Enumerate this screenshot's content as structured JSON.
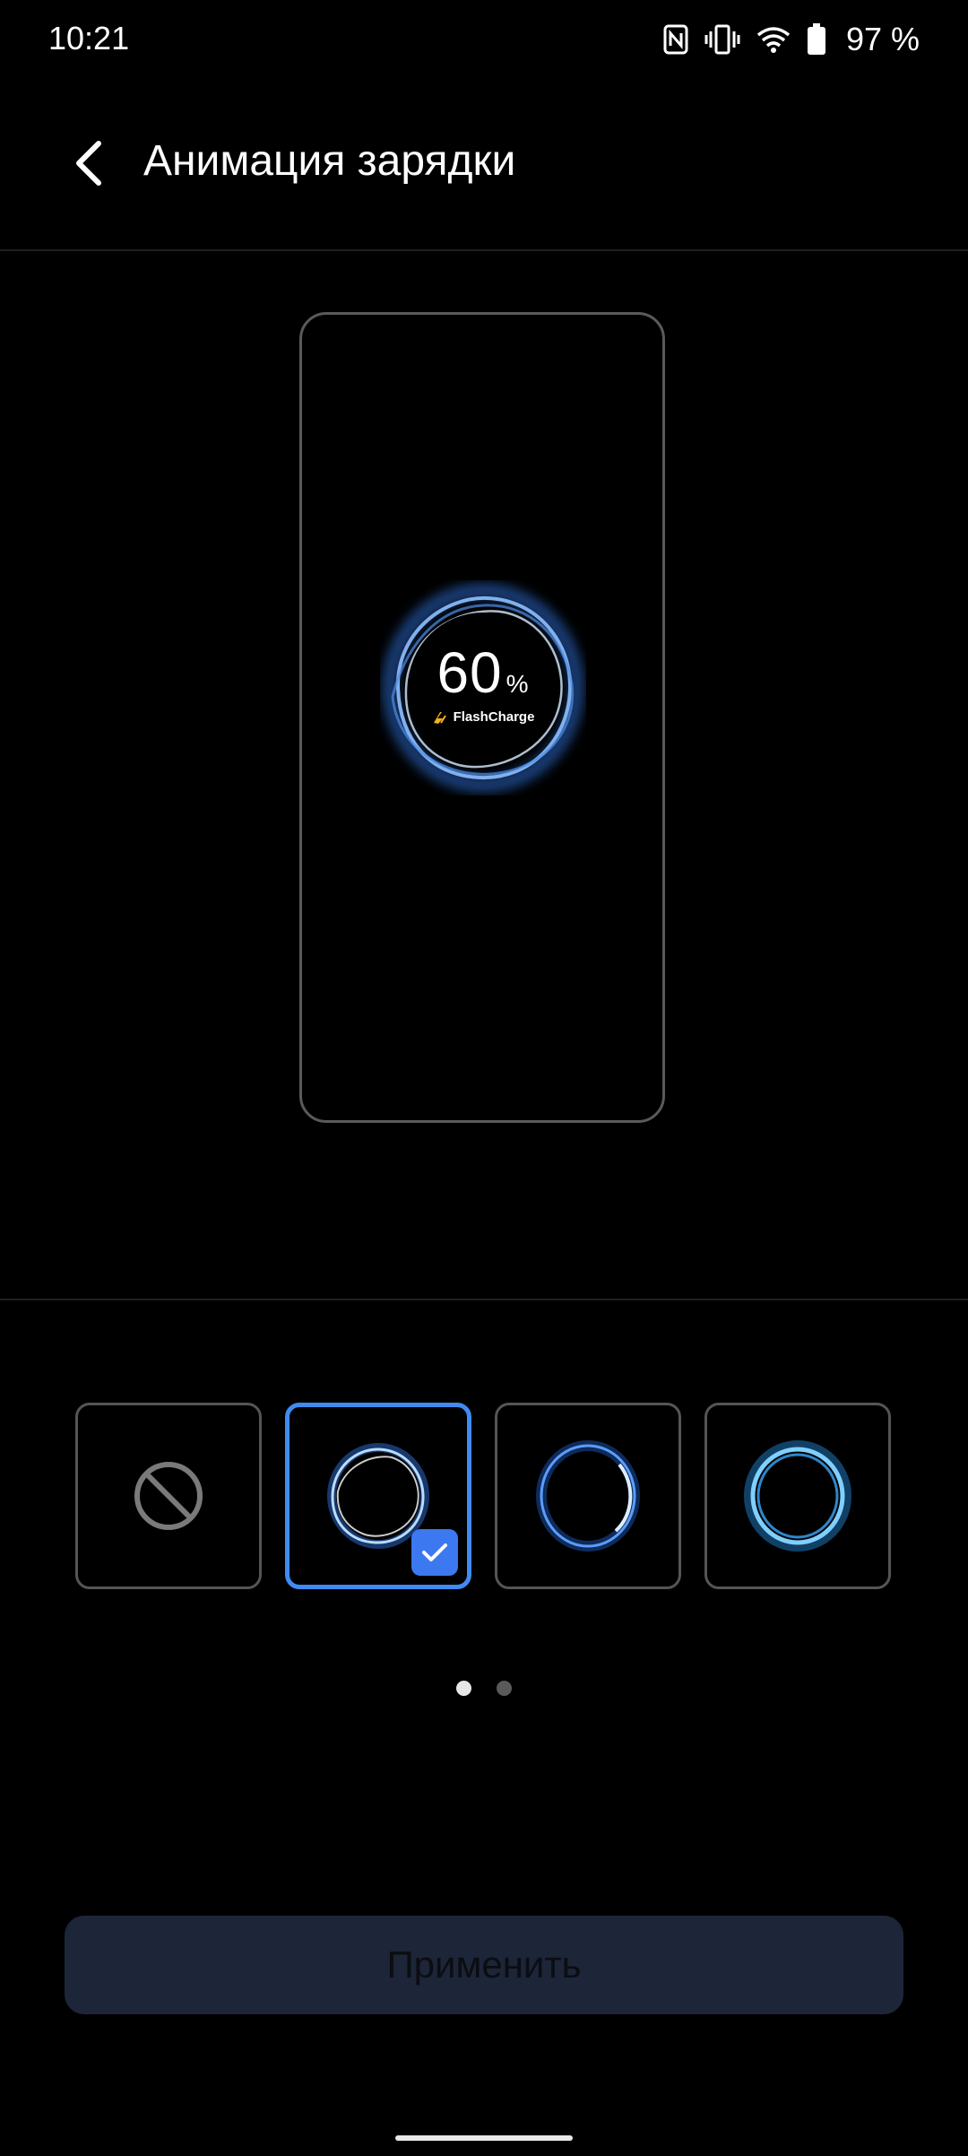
{
  "status_bar": {
    "time": "10:21",
    "icons": [
      "nfc-icon",
      "vibrate-icon",
      "wifi-icon",
      "battery-icon"
    ],
    "battery_text": "97 %"
  },
  "header": {
    "back_icon": "arrow-left-icon",
    "title": "Анимация зарядки"
  },
  "preview": {
    "percent_value": "60",
    "percent_sign": "%",
    "brand": "FlashCharge",
    "accent_color": "#7fb4ff"
  },
  "options": [
    {
      "name": "none",
      "icon": "no-entry-icon",
      "selected": false
    },
    {
      "name": "wave-ring",
      "icon": "wave-ring-icon",
      "selected": true
    },
    {
      "name": "glow-ring",
      "icon": "glow-ring-icon",
      "selected": false
    },
    {
      "name": "bright-ring",
      "icon": "bright-ring-icon",
      "selected": false
    }
  ],
  "pager": {
    "pages": 2,
    "current": 1
  },
  "apply_button": {
    "label": "Применить",
    "enabled": false
  },
  "colors": {
    "background": "#000000",
    "selected_border": "#3f8bf2",
    "check_badge": "#3c78f0",
    "apply_button_bg": "#1d2538"
  }
}
